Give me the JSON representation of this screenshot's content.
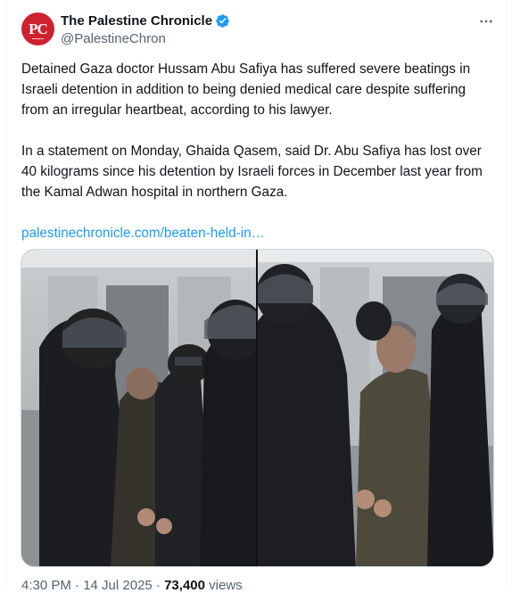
{
  "author": {
    "display_name": "The Palestine Chronicle",
    "handle": "@PalestineChron",
    "avatar_text": "PC",
    "verified": true
  },
  "tweet": {
    "paragraph1": "Detained Gaza doctor Hussam Abu Safiya has suffered severe beatings in Israeli detention in addition to being denied medical care despite suffering from an irregular heartbeat, according to his lawyer.",
    "paragraph2": "In a statement on Monday, Ghaida Qasem, said Dr. Abu Safiya has lost over 40 kilograms since his detention by Israeli forces in December last year from the Kamal Adwan hospital in northern Gaza.",
    "link_text": "palestinechronicle.com/beaten-held-in…"
  },
  "footer": {
    "time": "4:30 PM · 14 Jul 2025 · ",
    "views_count": "73,400",
    "views_label": " views"
  },
  "colors": {
    "link": "#1d9bf0",
    "verified": "#1d9bf0",
    "avatar": "#d0212f"
  },
  "icons": {
    "more": "more-horizontal-icon",
    "verified": "verified-badge-icon"
  }
}
